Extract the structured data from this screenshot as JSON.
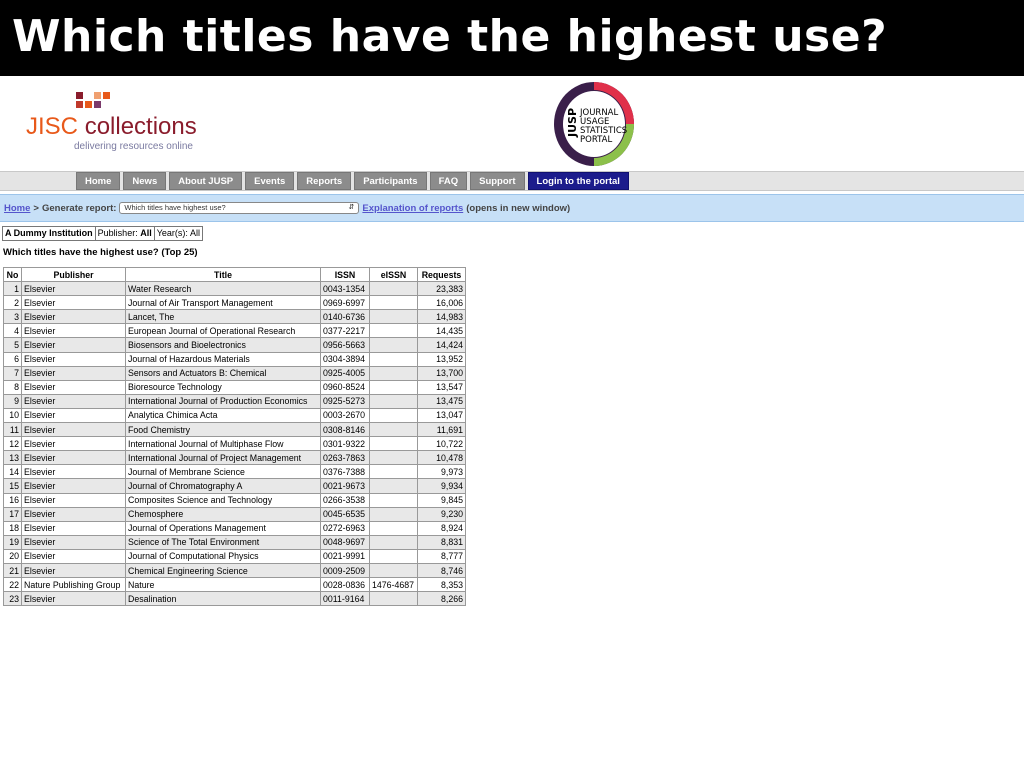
{
  "slide": {
    "title": "Which titles have the highest use?"
  },
  "jisc": {
    "word_a": "JISC",
    "word_b": "collections",
    "tagline": "delivering resources online"
  },
  "jusp": {
    "initials": "JUSP",
    "lines": [
      "JOURNAL",
      "USAGE",
      "STATISTICS",
      "PORTAL"
    ]
  },
  "nav": {
    "items": [
      "Home",
      "News",
      "About JUSP",
      "Events",
      "Reports",
      "Participants",
      "FAQ",
      "Support",
      "Login to the portal"
    ]
  },
  "breadcrumb": {
    "home": "Home",
    "separator": ">",
    "label": "Generate report:",
    "selected_report": "Which titles have highest use?",
    "explanation_link": "Explanation of reports",
    "note": "(opens in new window)"
  },
  "filters": {
    "institution": "A Dummy Institution",
    "publisher_label": "Publisher:",
    "publisher_value": "All",
    "years_label": "Year(s):",
    "years_value": "All"
  },
  "report": {
    "heading": "Which titles have the highest use? (Top 25)",
    "columns": [
      "No",
      "Publisher",
      "Title",
      "ISSN",
      "eISSN",
      "Requests"
    ],
    "rows": [
      [
        "1",
        "Elsevier",
        "Water Research",
        "0043-1354",
        "",
        "23,383"
      ],
      [
        "2",
        "Elsevier",
        "Journal of Air Transport Management",
        "0969-6997",
        "",
        "16,006"
      ],
      [
        "3",
        "Elsevier",
        "Lancet, The",
        "0140-6736",
        "",
        "14,983"
      ],
      [
        "4",
        "Elsevier",
        "European Journal of Operational Research",
        "0377-2217",
        "",
        "14,435"
      ],
      [
        "5",
        "Elsevier",
        "Biosensors and Bioelectronics",
        "0956-5663",
        "",
        "14,424"
      ],
      [
        "6",
        "Elsevier",
        "Journal of Hazardous Materials",
        "0304-3894",
        "",
        "13,952"
      ],
      [
        "7",
        "Elsevier",
        "Sensors and Actuators B: Chemical",
        "0925-4005",
        "",
        "13,700"
      ],
      [
        "8",
        "Elsevier",
        "Bioresource Technology",
        "0960-8524",
        "",
        "13,547"
      ],
      [
        "9",
        "Elsevier",
        "International Journal of Production Economics",
        "0925-5273",
        "",
        "13,475"
      ],
      [
        "10",
        "Elsevier",
        "Analytica Chimica Acta",
        "0003-2670",
        "",
        "13,047"
      ],
      [
        "11",
        "Elsevier",
        "Food Chemistry",
        "0308-8146",
        "",
        "11,691"
      ],
      [
        "12",
        "Elsevier",
        "International Journal of Multiphase Flow",
        "0301-9322",
        "",
        "10,722"
      ],
      [
        "13",
        "Elsevier",
        "International Journal of Project Management",
        "0263-7863",
        "",
        "10,478"
      ],
      [
        "14",
        "Elsevier",
        "Journal of Membrane Science",
        "0376-7388",
        "",
        "9,973"
      ],
      [
        "15",
        "Elsevier",
        "Journal of Chromatography A",
        "0021-9673",
        "",
        "9,934"
      ],
      [
        "16",
        "Elsevier",
        "Composites Science and Technology",
        "0266-3538",
        "",
        "9,845"
      ],
      [
        "17",
        "Elsevier",
        "Chemosphere",
        "0045-6535",
        "",
        "9,230"
      ],
      [
        "18",
        "Elsevier",
        "Journal of Operations Management",
        "0272-6963",
        "",
        "8,924"
      ],
      [
        "19",
        "Elsevier",
        "Science of The Total Environment",
        "0048-9697",
        "",
        "8,831"
      ],
      [
        "20",
        "Elsevier",
        "Journal of Computational Physics",
        "0021-9991",
        "",
        "8,777"
      ],
      [
        "21",
        "Elsevier",
        "Chemical Engineering Science",
        "0009-2509",
        "",
        "8,746"
      ],
      [
        "22",
        "Nature Publishing Group",
        "Nature",
        "0028-0836",
        "1476-4687",
        "8,353"
      ],
      [
        "23",
        "Elsevier",
        "Desalination",
        "0011-9164",
        "",
        "8,266"
      ]
    ]
  },
  "colors": {
    "header_bg": "#000000",
    "nav_bg": "#8c8c8c",
    "portal_bg": "#1c1c8c",
    "breadbar_bg": "#c7e0f7",
    "row_alt": "#e8e8e8",
    "jisc_orange": "#e8591a",
    "jisc_maroon": "#8a1c2c"
  }
}
